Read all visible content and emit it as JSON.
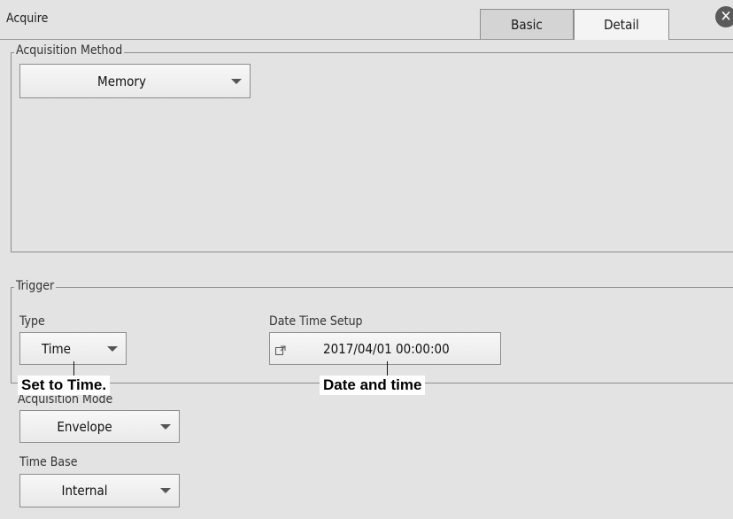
{
  "window": {
    "title": "Acquire"
  },
  "tabs": [
    {
      "label": "Basic"
    },
    {
      "label": "Detail"
    }
  ],
  "acquisition_method": {
    "label": "Acquisition Method",
    "value": "Memory"
  },
  "trigger": {
    "label": "Trigger",
    "type_label": "Type",
    "type_value": "Time",
    "datetime_label": "Date Time Setup",
    "datetime_value": "2017/04/01 00:00:00"
  },
  "acquisition_mode": {
    "label": "Acquisition Mode",
    "value": "Envelope"
  },
  "time_base": {
    "label": "Time Base",
    "value": "Internal"
  },
  "callouts": {
    "type": "Set to Time.",
    "datetime": "Date and time"
  }
}
